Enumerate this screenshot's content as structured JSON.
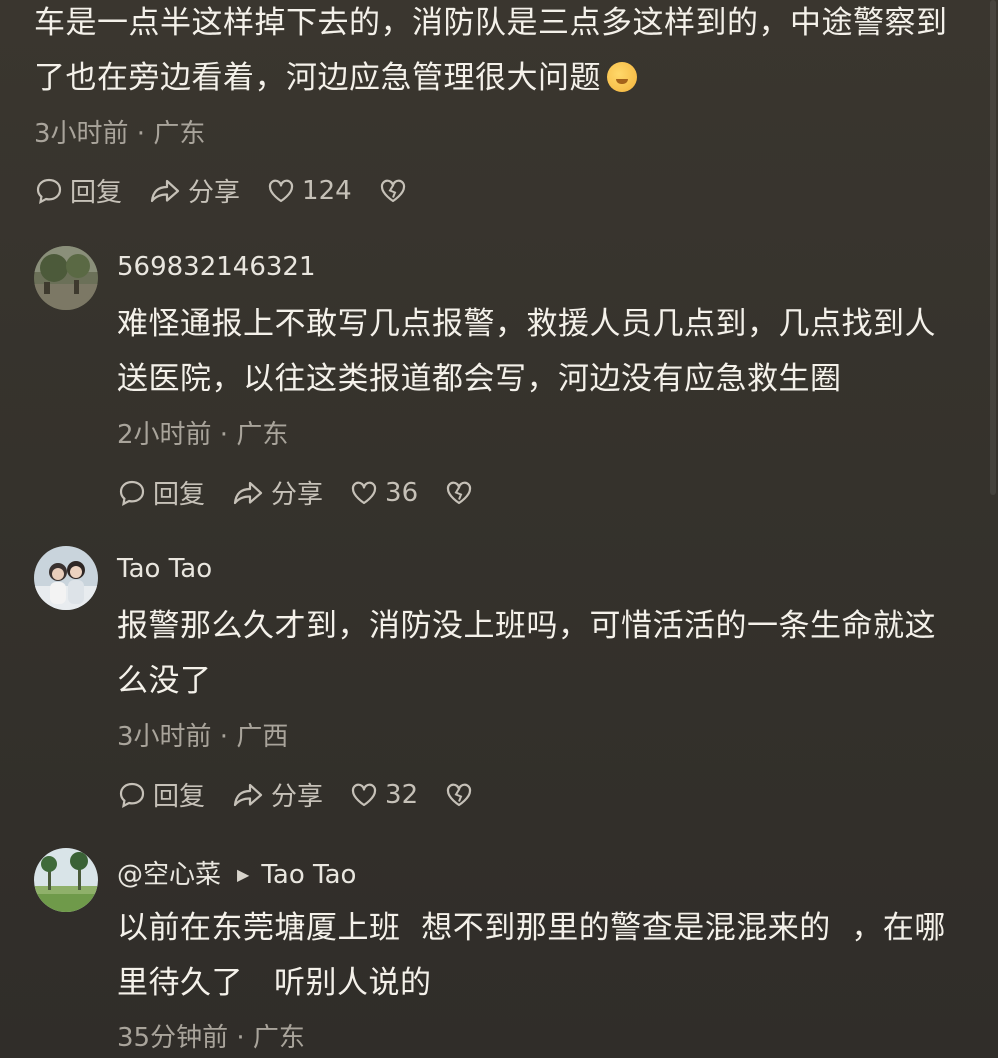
{
  "comments": [
    {
      "id": "c0",
      "text": "车是一点半这样掉下去的，消防队是三点多这样到的，中途警察到了也在旁边看着，河边应急管理很大问题",
      "has_emoji": true,
      "meta": "3小时前 · 广东",
      "reply_label": "回复",
      "share_label": "分享",
      "likes": "124"
    },
    {
      "id": "c1",
      "username": "569832146321",
      "text": "难怪通报上不敢写几点报警，救援人员几点到，几点找到人送医院，以往这类报道都会写，河边没有应急救生圈",
      "meta": "2小时前 · 广东",
      "reply_label": "回复",
      "share_label": "分享",
      "likes": "36"
    },
    {
      "id": "c2",
      "username": "Tao Tao",
      "text": "报警那么久才到，消防没上班吗，可惜活活的一条生命就这么没了",
      "meta": "3小时前 · 广西",
      "reply_label": "回复",
      "share_label": "分享",
      "likes": "32"
    },
    {
      "id": "c3",
      "username": "@空心菜",
      "reply_to": "Tao Tao",
      "text": "以前在东莞塘厦上班  想不到那里的警查是混混来的  ，在哪里待久了   听别人说的",
      "meta": "35分钟前 · 广东"
    }
  ],
  "colors": {
    "background": "#36332d",
    "text_primary": "#f4f1ea",
    "text_secondary": "#a9a49b",
    "action_color": "#c6c1b8"
  },
  "icons": {
    "reply": "chat-bubble-icon",
    "share": "share-arrow-icon",
    "like": "heart-icon",
    "dislike": "broken-heart-icon"
  }
}
